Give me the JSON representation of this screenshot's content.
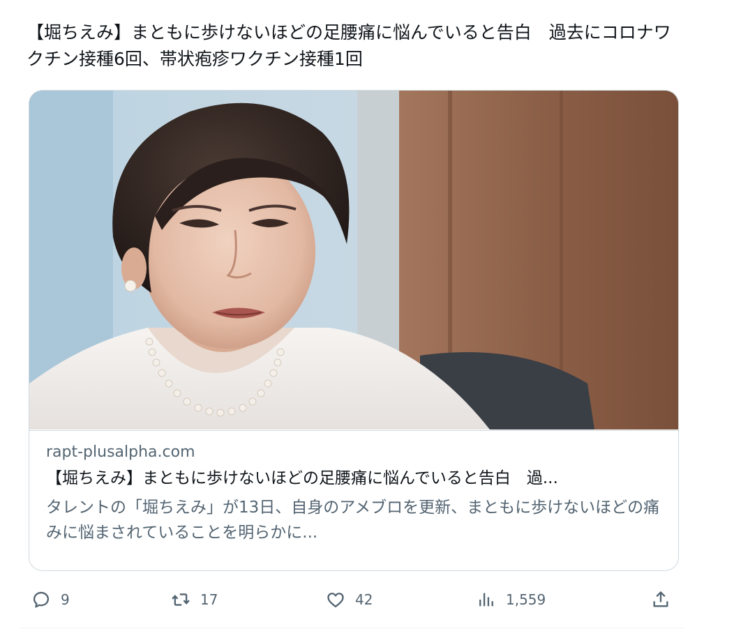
{
  "tweet": {
    "text": "【堀ちえみ】まともに歩けないほどの足腰痛に悩んでいると告白　過去にコロナワクチン接種6回、帯状疱疹ワクチン接種1回"
  },
  "card": {
    "domain": "rapt-plusalpha.com",
    "title": "【堀ちえみ】まともに歩けないほどの足腰痛に悩んでいると告白　過...",
    "description": "タレントの「堀ちえみ」が13日、自身のアメブロを更新、まともに歩けないほどの痛みに悩まされていることを明らかに..."
  },
  "actions": {
    "reply": {
      "icon": "reply-icon",
      "count": "9"
    },
    "retweet": {
      "icon": "retweet-icon",
      "count": "17"
    },
    "like": {
      "icon": "heart-icon",
      "count": "42"
    },
    "views": {
      "icon": "views-icon",
      "count": "1,559"
    },
    "share": {
      "icon": "share-icon"
    }
  },
  "colors": {
    "text_primary": "#0f1419",
    "text_secondary": "#536471",
    "border": "#cfd9de"
  }
}
